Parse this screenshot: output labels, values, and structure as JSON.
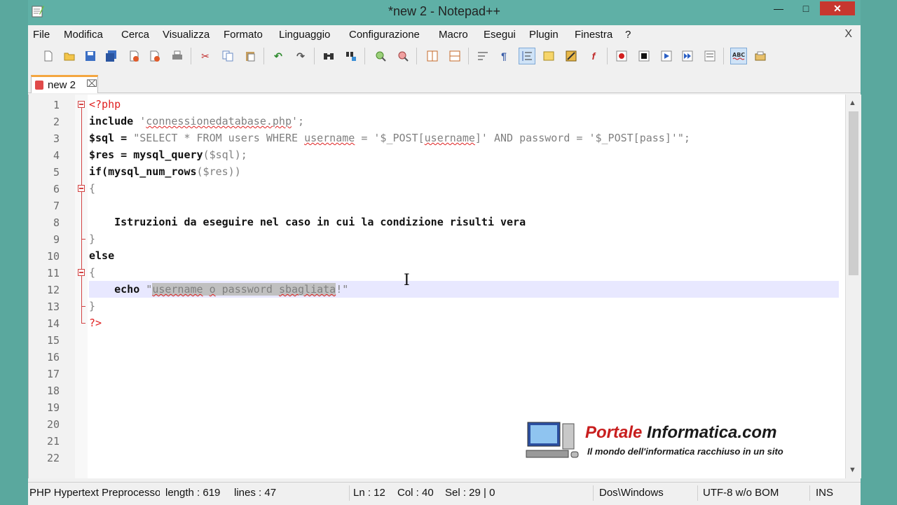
{
  "window": {
    "title": "*new  2 - Notepad++"
  },
  "menu": [
    "File",
    "Modifica",
    "Cerca",
    "Visualizza",
    "Formato",
    "Linguaggio",
    "Configurazione",
    "Macro",
    "Esegui",
    "Plugin",
    "Finestra",
    "?"
  ],
  "menu_close": "X",
  "toolbar_icons": [
    "new-file-icon",
    "open-file-icon",
    "save-icon",
    "save-all-icon",
    "close-icon",
    "close-all-icon",
    "print-icon",
    "cut-icon",
    "copy-icon",
    "paste-icon",
    "undo-icon",
    "redo-icon",
    "find-icon",
    "replace-icon",
    "zoom-in-icon",
    "zoom-out-icon",
    "sync-vertical-icon",
    "sync-horizontal-icon",
    "word-wrap-icon",
    "show-all-chars-icon",
    "indent-guide-icon",
    "user-lang-icon",
    "doc-map-icon",
    "function-list-icon",
    "record-macro-icon",
    "stop-record-icon",
    "play-macro-icon",
    "run-macro-multiple-icon",
    "save-macro-icon",
    "spell-check-icon",
    "spell-options-icon"
  ],
  "tab": {
    "label": "new 2"
  },
  "editor": {
    "line_numbers": [
      "1",
      "2",
      "3",
      "4",
      "5",
      "6",
      "7",
      "8",
      "9",
      "10",
      "11",
      "12",
      "13",
      "14",
      "15",
      "16",
      "17",
      "18",
      "19",
      "20",
      "21",
      "22"
    ],
    "lines": [
      [
        {
          "t": "<?php",
          "c": "php"
        }
      ],
      [
        {
          "t": "include ",
          "c": "b"
        },
        {
          "t": "'",
          "c": "str"
        },
        {
          "t": "connessionedatabase.php",
          "c": "str squig"
        },
        {
          "t": "';",
          "c": "str"
        }
      ],
      [
        {
          "t": "$sql = ",
          "c": "b"
        },
        {
          "t": "\"SELECT * FROM users WHERE ",
          "c": "str"
        },
        {
          "t": "username",
          "c": "str squig"
        },
        {
          "t": " = '$_POST[",
          "c": "str"
        },
        {
          "t": "username",
          "c": "str squig"
        },
        {
          "t": "]' AND password = '$_POST[pass]'\";",
          "c": "str"
        }
      ],
      [
        {
          "t": "$res = ",
          "c": "b"
        },
        {
          "t": "mysql_query",
          "c": "b"
        },
        {
          "t": "($sql);",
          "c": "str"
        }
      ],
      [
        {
          "t": "if(",
          "c": "b"
        },
        {
          "t": "mysql_num_rows",
          "c": "b"
        },
        {
          "t": "($res))",
          "c": "str"
        }
      ],
      [
        {
          "t": "{",
          "c": "str"
        }
      ],
      [],
      [
        {
          "t": "    Istruzioni da eseguire nel caso in cui la condizione risulti vera",
          "c": "b"
        }
      ],
      [
        {
          "t": "}",
          "c": "str"
        }
      ],
      [
        {
          "t": "else",
          "c": "b"
        }
      ],
      [
        {
          "t": "{",
          "c": "str"
        }
      ],
      [
        {
          "t": "    echo ",
          "c": "b"
        },
        {
          "t": "\"",
          "c": "str"
        },
        {
          "t": "username",
          "c": "str sel squig"
        },
        {
          "t": " ",
          "c": "str sel"
        },
        {
          "t": "o",
          "c": "str sel squig"
        },
        {
          "t": " password ",
          "c": "str sel"
        },
        {
          "t": "sbagliata",
          "c": "str sel squig"
        },
        {
          "t": "!\"",
          "c": "str"
        }
      ],
      [
        {
          "t": "}",
          "c": "str"
        }
      ],
      [
        {
          "t": "?>",
          "c": "php"
        }
      ]
    ]
  },
  "status": {
    "language": "PHP Hypertext Preprocessor file",
    "length": "length : 619",
    "lines": "lines : 47",
    "ln": "Ln : 12",
    "col": "Col : 40",
    "sel": "Sel : 29 | 0",
    "eol": "Dos\\Windows",
    "encoding": "UTF-8 w/o BOM",
    "mode": "INS"
  },
  "watermark": {
    "title_part1": "Portale ",
    "title_part2": "Informatica.com",
    "subtitle": "Il mondo dell'informatica racchiuso in un sito"
  },
  "colors": {
    "titlebar": "#5fb0a6",
    "php_tag": "#e02020",
    "string": "#808080",
    "current_line": "#e8e8ff",
    "selection": "#c0c0c0",
    "watermark_red": "#c81e1e"
  }
}
